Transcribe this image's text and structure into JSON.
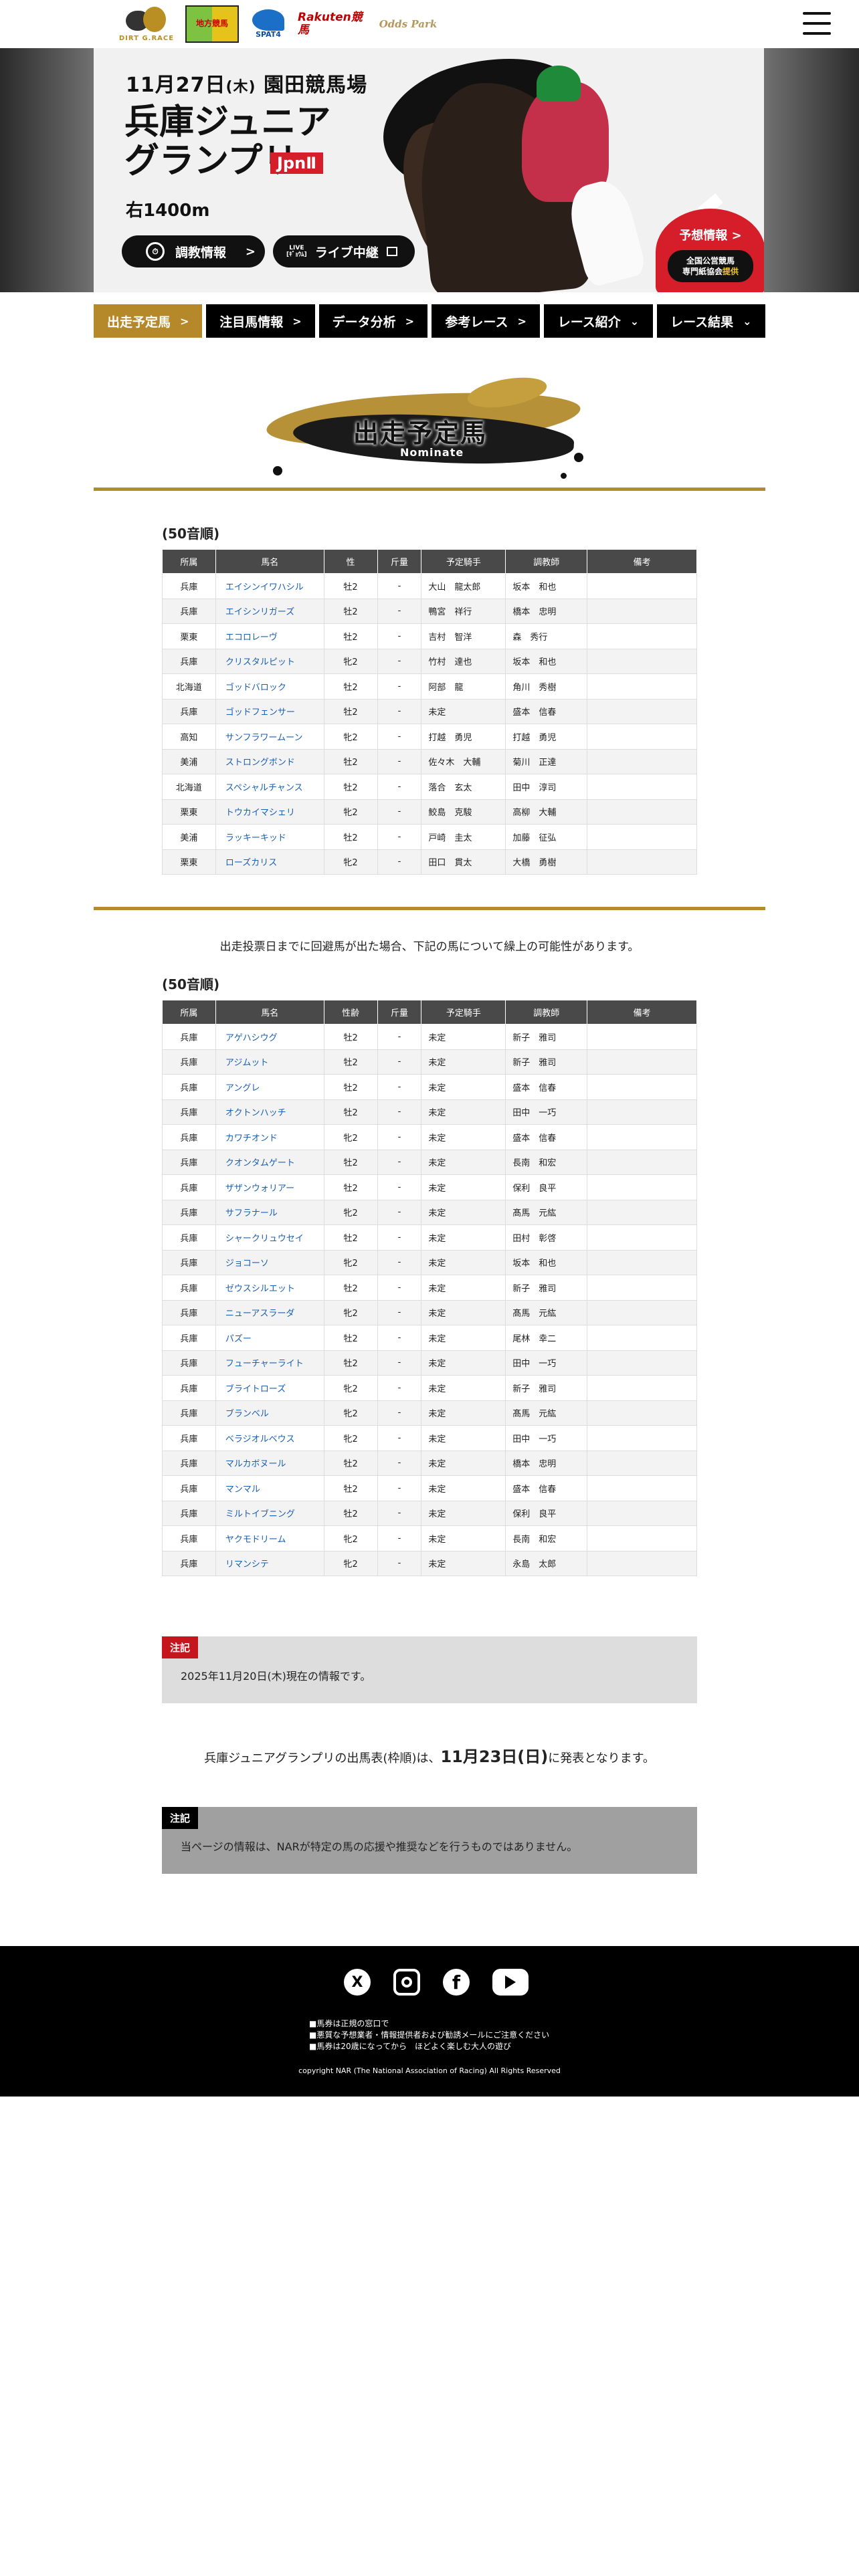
{
  "header": {
    "logos": [
      "DIRT G.RACE",
      "地方競馬",
      "SPAT4",
      "Rakuten競馬",
      "Odds Park"
    ]
  },
  "hero": {
    "date": "11月27日",
    "weekday": "(木)",
    "venue": "園田競馬場",
    "title_line1": "兵庫ジュニア",
    "title_line2": "グランプリ",
    "grade": "JpnⅡ",
    "distance": "右1400m",
    "training_button": "調教情報",
    "live_small": "LIVE\n[ｷﾞｮｳﾑ]",
    "live_button": "ライブ中継",
    "forecast_title": "予想情報",
    "forecast_line1": "全国公営競馬",
    "forecast_line2": "専門紙協会",
    "forecast_line3": "提供"
  },
  "nav": {
    "tabs": [
      "出走予定馬",
      "注目馬情報",
      "データ分析",
      "参考レース",
      "レース紹介",
      "レース結果"
    ],
    "active": "出走予定馬"
  },
  "section": {
    "title": "出走予定馬",
    "subtitle": "Nominate"
  },
  "table1": {
    "order_label": "(50音順)",
    "headers": [
      "所属",
      "馬名",
      "性",
      "斤量",
      "予定騎手",
      "調教師",
      "備考"
    ],
    "rows": [
      [
        "兵庫",
        "エイシンイワハシル",
        "牡2",
        "-",
        "大山　龍太郎",
        "坂本　和也",
        ""
      ],
      [
        "兵庫",
        "エイシンリガーズ",
        "牡2",
        "-",
        "鴨宮　祥行",
        "橋本　忠明",
        ""
      ],
      [
        "栗東",
        "エコロレーヴ",
        "牡2",
        "-",
        "吉村　智洋",
        "森　秀行",
        ""
      ],
      [
        "兵庫",
        "クリスタルピット",
        "牝2",
        "-",
        "竹村　達也",
        "坂本　和也",
        ""
      ],
      [
        "北海道",
        "ゴッドバロック",
        "牡2",
        "-",
        "阿部　龍",
        "角川　秀樹",
        ""
      ],
      [
        "兵庫",
        "ゴッドフェンサー",
        "牡2",
        "-",
        "未定",
        "盛本　信春",
        ""
      ],
      [
        "高知",
        "サンフラワームーン",
        "牝2",
        "-",
        "打越　勇児",
        "打越　勇児",
        ""
      ],
      [
        "美浦",
        "ストロングボンド",
        "牡2",
        "-",
        "佐々木　大輔",
        "菊川　正達",
        ""
      ],
      [
        "北海道",
        "スペシャルチャンス",
        "牡2",
        "-",
        "落合　玄太",
        "田中　淳司",
        ""
      ],
      [
        "栗東",
        "トウカイマシェリ",
        "牝2",
        "-",
        "鮫島　克駿",
        "高柳　大輔",
        ""
      ],
      [
        "美浦",
        "ラッキーキッド",
        "牡2",
        "-",
        "戸崎　圭太",
        "加藤　征弘",
        ""
      ],
      [
        "栗東",
        "ローズカリス",
        "牝2",
        "-",
        "田口　貫太",
        "大橋　勇樹",
        ""
      ]
    ]
  },
  "notice": "出走投票日までに回避馬が出た場合、下記の馬について繰上の可能性があります。",
  "table2": {
    "order_label": "(50音順)",
    "headers": [
      "所属",
      "馬名",
      "性齢",
      "斤量",
      "予定騎手",
      "調教師",
      "備考"
    ],
    "rows": [
      [
        "兵庫",
        "アゲハシウグ",
        "牡2",
        "-",
        "未定",
        "新子　雅司",
        ""
      ],
      [
        "兵庫",
        "アジムット",
        "牡2",
        "-",
        "未定",
        "新子　雅司",
        ""
      ],
      [
        "兵庫",
        "アングレ",
        "牡2",
        "-",
        "未定",
        "盛本　信春",
        ""
      ],
      [
        "兵庫",
        "オクトンハッチ",
        "牡2",
        "-",
        "未定",
        "田中　一巧",
        ""
      ],
      [
        "兵庫",
        "カワチオンド",
        "牝2",
        "-",
        "未定",
        "盛本　信春",
        ""
      ],
      [
        "兵庫",
        "クオンタムゲート",
        "牡2",
        "-",
        "未定",
        "長南　和宏",
        ""
      ],
      [
        "兵庫",
        "ザザンウォリアー",
        "牡2",
        "-",
        "未定",
        "保利　良平",
        ""
      ],
      [
        "兵庫",
        "サフラナール",
        "牝2",
        "-",
        "未定",
        "髙馬　元紘",
        ""
      ],
      [
        "兵庫",
        "シャークリュウセイ",
        "牡2",
        "-",
        "未定",
        "田村　彰啓",
        ""
      ],
      [
        "兵庫",
        "ジョコーソ",
        "牝2",
        "-",
        "未定",
        "坂本　和也",
        ""
      ],
      [
        "兵庫",
        "ゼウスシルエット",
        "牡2",
        "-",
        "未定",
        "新子　雅司",
        ""
      ],
      [
        "兵庫",
        "ニューアスラーダ",
        "牝2",
        "-",
        "未定",
        "髙馬　元紘",
        ""
      ],
      [
        "兵庫",
        "パズー",
        "牡2",
        "-",
        "未定",
        "尾林　幸二",
        ""
      ],
      [
        "兵庫",
        "フューチャーライト",
        "牡2",
        "-",
        "未定",
        "田中　一巧",
        ""
      ],
      [
        "兵庫",
        "ブライトローズ",
        "牝2",
        "-",
        "未定",
        "新子　雅司",
        ""
      ],
      [
        "兵庫",
        "ブランベル",
        "牝2",
        "-",
        "未定",
        "髙馬　元紘",
        ""
      ],
      [
        "兵庫",
        "ベラジオルベウス",
        "牝2",
        "-",
        "未定",
        "田中　一巧",
        ""
      ],
      [
        "兵庫",
        "マルカボヌール",
        "牡2",
        "-",
        "未定",
        "橋本　忠明",
        ""
      ],
      [
        "兵庫",
        "マンマル",
        "牡2",
        "-",
        "未定",
        "盛本　信春",
        ""
      ],
      [
        "兵庫",
        "ミルトイブニング",
        "牡2",
        "-",
        "未定",
        "保利　良平",
        ""
      ],
      [
        "兵庫",
        "ヤクモドリーム",
        "牝2",
        "-",
        "未定",
        "長南　和宏",
        ""
      ],
      [
        "兵庫",
        "リマンシテ",
        "牝2",
        "-",
        "未定",
        "永島　太郎",
        ""
      ]
    ]
  },
  "note1": {
    "tag": "注記",
    "text": "2025年11月20日(木)現在の情報です。"
  },
  "announce": {
    "before": "兵庫ジュニアグランプリの出馬表(枠順)は、",
    "date": "11月23日(日)",
    "after": "に発表となります。"
  },
  "note2": {
    "tag": "注記",
    "text": "当ページの情報は、NARが特定の馬の応援や推奨などを行うものではありません。"
  },
  "footer": {
    "links": [
      "■馬券は正規の窓口で",
      "■悪質な予想業者・情報提供者および勧誘メールにご注意ください",
      "■馬券は20歳になってから　ほどよく楽しむ大人の遊び"
    ],
    "copyright": "copyright NAR (The National Association of Racing) All Rights Reserved"
  },
  "colors": {
    "gold": "#b28b2c",
    "red": "#d61e2b",
    "link_blue": "#1a5fb4"
  }
}
